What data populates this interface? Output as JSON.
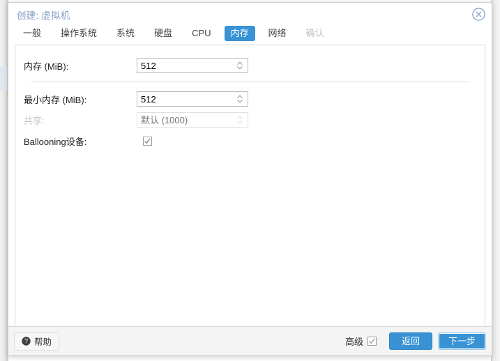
{
  "dialog": {
    "title": "创建: 虚拟机",
    "close_icon": "close-circle-icon"
  },
  "tabs": [
    {
      "label": "一般",
      "state": "normal"
    },
    {
      "label": "操作系统",
      "state": "normal"
    },
    {
      "label": "系统",
      "state": "normal"
    },
    {
      "label": "硬盘",
      "state": "normal"
    },
    {
      "label": "CPU",
      "state": "normal"
    },
    {
      "label": "内存",
      "state": "active"
    },
    {
      "label": "网络",
      "state": "normal"
    },
    {
      "label": "确认",
      "state": "disabled"
    }
  ],
  "form": {
    "memory": {
      "label": "内存 (MiB):",
      "value": "512",
      "placeholder": "",
      "disabled": false
    },
    "min_memory": {
      "label": "最小内存 (MiB):",
      "value": "512",
      "placeholder": "",
      "disabled": false
    },
    "shares": {
      "label": "共享:",
      "value": "",
      "placeholder": "默认 (1000)",
      "disabled": true
    },
    "ballooning": {
      "label": "Ballooning设备:",
      "checked": true
    }
  },
  "footer": {
    "help_label": "帮助",
    "help_icon": "question-circle-icon",
    "advanced_label": "高级",
    "advanced_checked": true,
    "back_label": "返回",
    "next_label": "下一步"
  },
  "colors": {
    "accent": "#3892d4",
    "title": "#7f9ec4",
    "disabled_text": "#c8c8c8",
    "footer_bg": "#f4f4f4"
  }
}
